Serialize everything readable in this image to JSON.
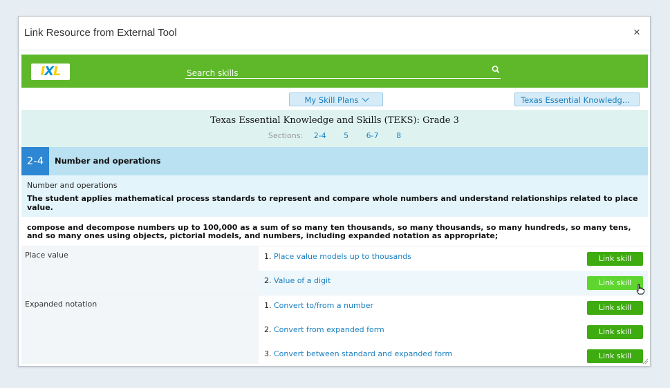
{
  "modal": {
    "title": "Link Resource from External Tool",
    "close_glyph": "×"
  },
  "ixl": {
    "logo_text_1": "I",
    "logo_text_2": "X",
    "logo_text_3": "L",
    "search_placeholder": "Search skills"
  },
  "filters": {
    "skill_plans_label": "My Skill Plans",
    "standard_label": "Texas Essential Knowledg..."
  },
  "standard": {
    "title": "Texas Essential Knowledge and Skills (TEKS): Grade 3",
    "sections_label": "Sections:",
    "sections": [
      "2-4",
      "5",
      "6-7",
      "8"
    ]
  },
  "section": {
    "number": "2-4",
    "name": "Number and operations",
    "desc_heading": "Number and operations",
    "desc_statement": "The student applies mathematical process standards to represent and compare whole numbers and understand relationships related to place value.",
    "knowledge_statement": "compose and decompose numbers up to 100,000 as a sum of so many ten thousands, so many thousands, so many hundreds, so many tens, and so many ones using objects, pictorial models, and numbers, including expanded notation as appropriate;"
  },
  "groups": [
    {
      "label": "Place value",
      "skills": [
        {
          "num": "1.",
          "name": "Place value models up to thousands",
          "button": "Link skill"
        },
        {
          "num": "2.",
          "name": "Value of a digit",
          "button": "Link skill"
        }
      ]
    },
    {
      "label": "Expanded notation",
      "skills": [
        {
          "num": "1.",
          "name": "Convert to/from a number",
          "button": "Link skill"
        },
        {
          "num": "2.",
          "name": "Convert from expanded form",
          "button": "Link skill"
        },
        {
          "num": "3.",
          "name": "Convert between standard and expanded form",
          "button": "Link skill"
        }
      ]
    }
  ],
  "colors": {
    "ixl_green": "#5eb82a",
    "link_button": "#3eab10",
    "section_blue": "#2d87d3"
  }
}
